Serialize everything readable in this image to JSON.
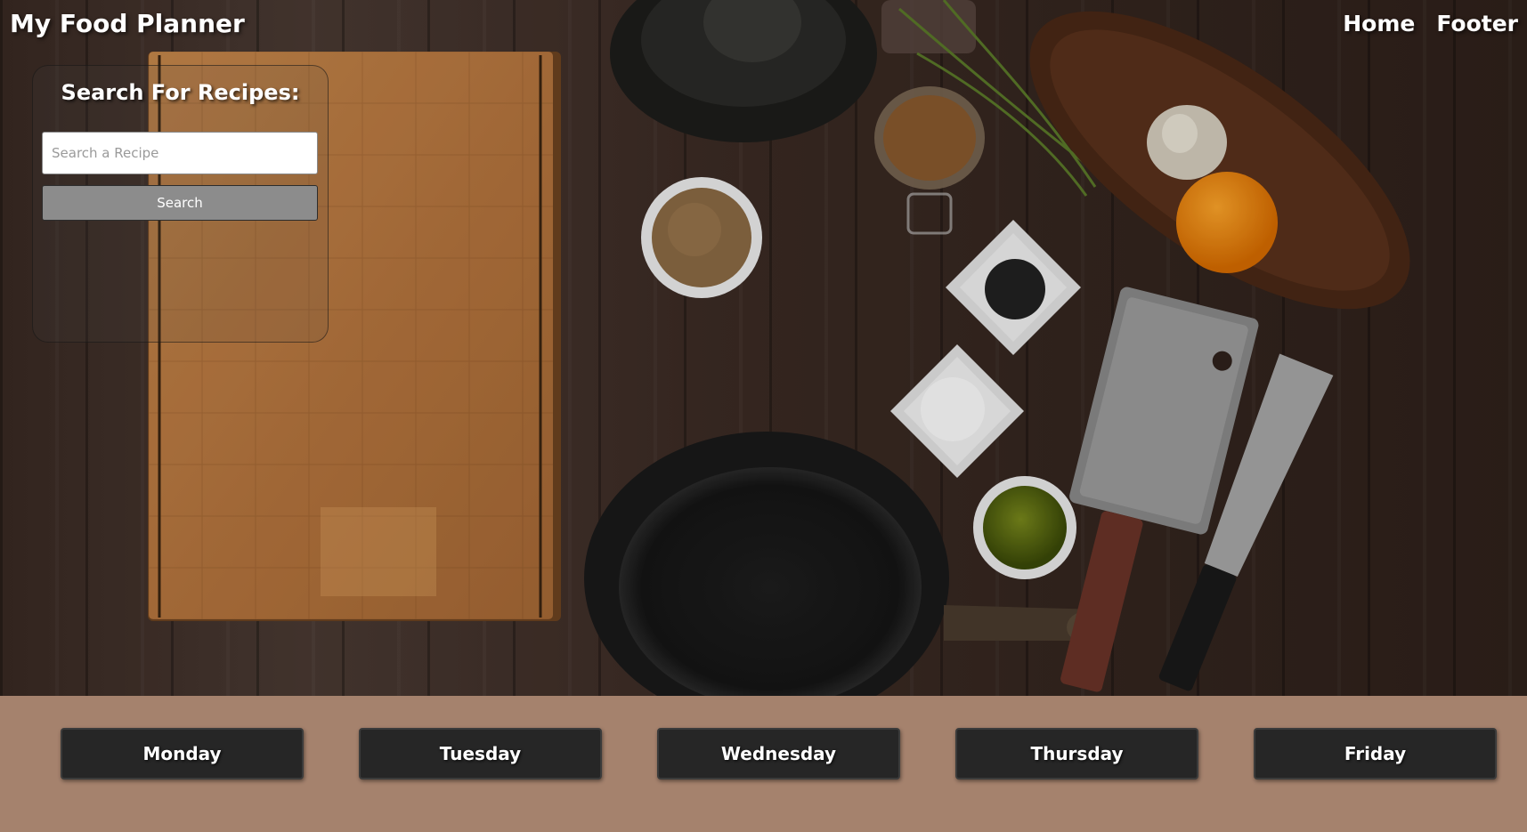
{
  "header": {
    "brand": "My Food Planner",
    "nav": [
      {
        "label": "Home"
      },
      {
        "label": "Footer"
      }
    ]
  },
  "search": {
    "title": "Search For Recipes:",
    "placeholder": "Search a Recipe",
    "value": "",
    "button_label": "Search"
  },
  "days": [
    {
      "label": "Monday"
    },
    {
      "label": "Tuesday"
    },
    {
      "label": "Wednesday"
    },
    {
      "label": "Thursday"
    },
    {
      "label": "Friday"
    }
  ],
  "colors": {
    "day_strip": "#a5826d",
    "day_button": "#262626",
    "search_button": "#8c8c8c"
  }
}
